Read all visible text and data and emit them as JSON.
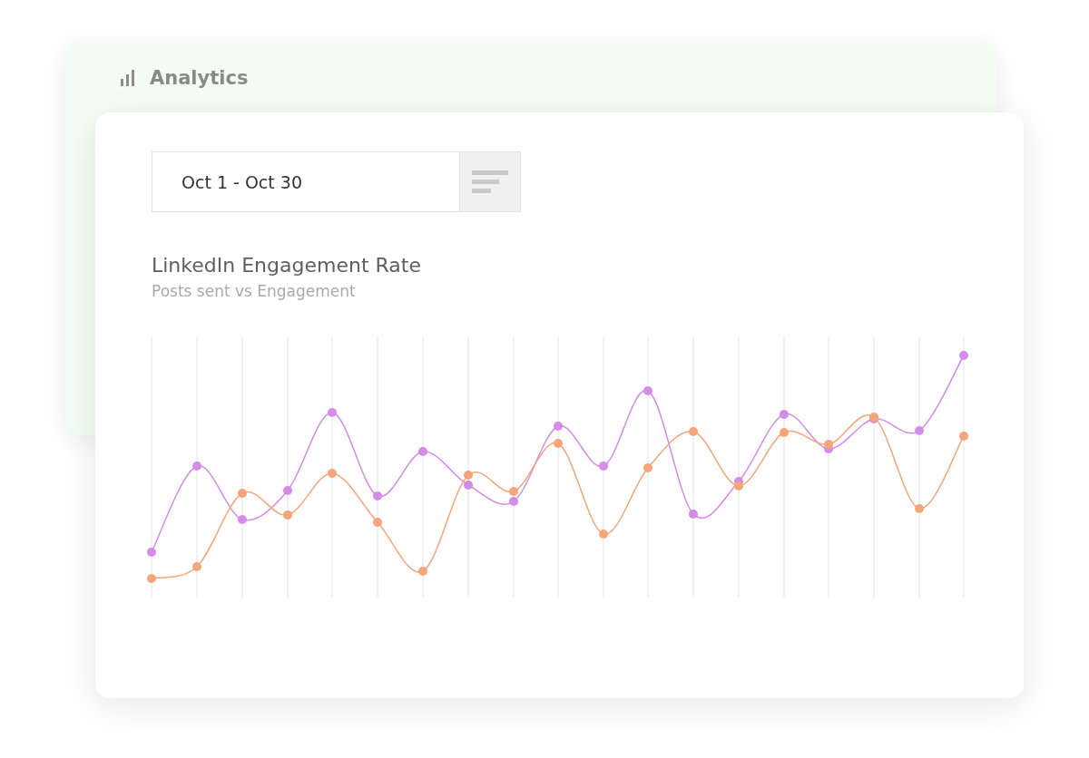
{
  "section": {
    "title": "Analytics"
  },
  "date_range": {
    "value": "Oct 1 - Oct 30"
  },
  "chart": {
    "title": "LinkedIn Engagement Rate",
    "subtitle": "Posts sent vs Engagement"
  }
}
